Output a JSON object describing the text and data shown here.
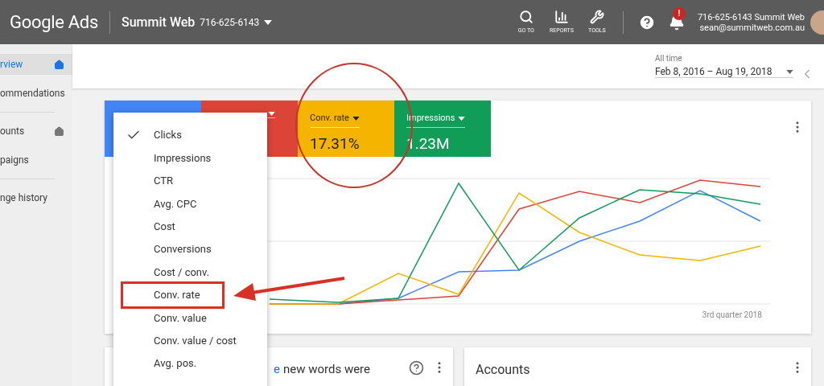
{
  "header": {
    "logo": "Google Ads",
    "account_name": "Summit Web",
    "account_id": "716-625-6143",
    "tools": [
      {
        "kind": "search",
        "label": "GO TO"
      },
      {
        "kind": "reports",
        "label": "REPORTS"
      },
      {
        "kind": "tools",
        "label": "TOOLS"
      }
    ],
    "notification_badge": "!",
    "user": {
      "name": "716-625-6143 Summit Web",
      "email": "sean@summitweb.com.au"
    }
  },
  "sidebar": {
    "groups": [
      [
        {
          "label": "rview",
          "selected": true,
          "kind": "pinned"
        },
        {
          "label": "ommendations",
          "selected": false,
          "kind": "plain"
        }
      ],
      [
        {
          "label": "ounts",
          "selected": false,
          "kind": "pinned"
        },
        {
          "label": "paigns",
          "selected": false,
          "kind": "plain"
        }
      ],
      [
        {
          "label": "nge history",
          "selected": false,
          "kind": "plain"
        }
      ]
    ]
  },
  "date_range": {
    "label": "All time",
    "range": "Feb 8, 2016 – Aug 19, 2018"
  },
  "metrics": [
    {
      "color": "#4285f4",
      "dropdown": false
    },
    {
      "color": "#db4437",
      "dropdown": true
    },
    {
      "color": "#f4b400",
      "dropdown": true,
      "label": "Conv. rate",
      "value": "17.31%"
    },
    {
      "color": "#0f9d58",
      "dropdown": true,
      "label": "Impressions",
      "value": "1.23M"
    }
  ],
  "chart": {
    "x_label": "3rd quarter 2018"
  },
  "metric_menu": [
    {
      "label": "Clicks",
      "checked": true,
      "annotated": false
    },
    {
      "label": "Impressions",
      "checked": false,
      "annotated": false
    },
    {
      "label": "CTR",
      "checked": false,
      "annotated": false
    },
    {
      "label": "Avg. CPC",
      "checked": false,
      "annotated": false
    },
    {
      "label": "Cost",
      "checked": false,
      "annotated": false
    },
    {
      "label": "Conversions",
      "checked": false,
      "annotated": false
    },
    {
      "label": "Cost / conv.",
      "checked": false,
      "annotated": false
    },
    {
      "label": "Conv. rate",
      "checked": false,
      "annotated": true
    },
    {
      "label": "Conv. value",
      "checked": false,
      "annotated": false
    },
    {
      "label": "Conv. value / cost",
      "checked": false,
      "annotated": false
    },
    {
      "label": "Avg. pos.",
      "checked": false,
      "annotated": false
    }
  ],
  "cards": [
    {
      "kind": "tip",
      "link": "e",
      "text": "new words were"
    },
    {
      "kind": "titled",
      "title": "Accounts"
    }
  ]
}
